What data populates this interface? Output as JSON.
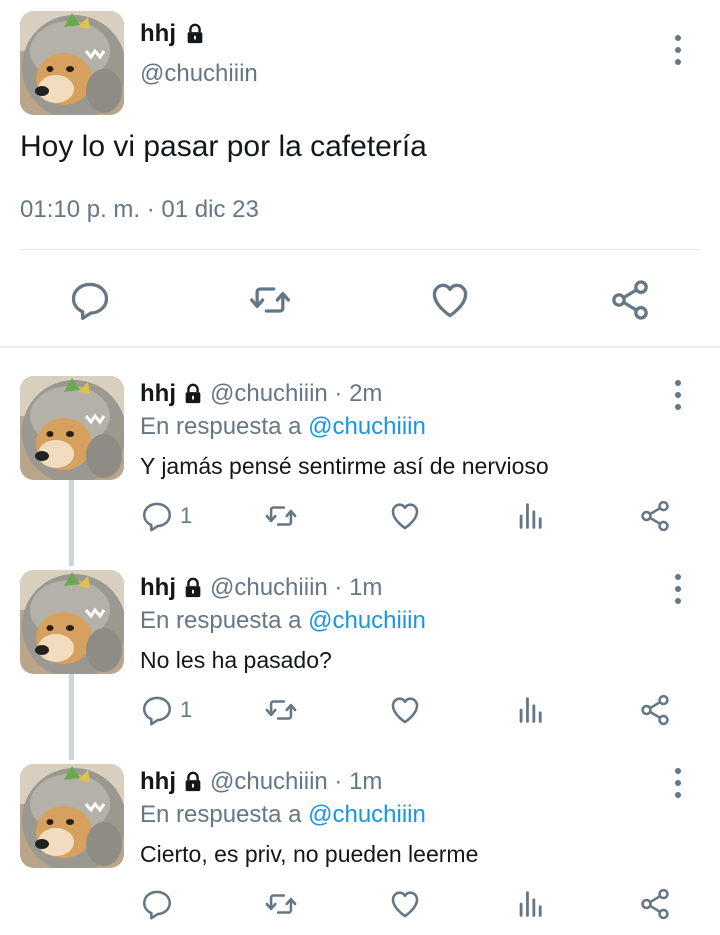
{
  "colors": {
    "text": "#14171a",
    "muted": "#657786",
    "link": "#1b95e0",
    "divider": "#e1e8ed",
    "thread": "#ccd6dd"
  },
  "tweet": {
    "name": "hhj",
    "handle": "@chuchiiin",
    "text": "Hoy lo vi pasar por la cafetería",
    "timestamp": "01:10 p. m. · 01 dic 23",
    "lock_icon": "lock-icon",
    "actions": [
      "reply-icon",
      "retweet-icon",
      "like-icon",
      "share-icon"
    ]
  },
  "replies": [
    {
      "name": "hhj",
      "handle_time": "@chuchiiin · 2m",
      "reply_prefix": "En respuesta a",
      "mention": "@chuchiiin",
      "text": "Y jamás pensé sentirme así de nervioso",
      "reply_count": "1"
    },
    {
      "name": "hhj",
      "handle_time": "@chuchiiin · 1m",
      "reply_prefix": "En respuesta a",
      "mention": "@chuchiiin",
      "text": "No les ha pasado?",
      "reply_count": "1"
    },
    {
      "name": "hhj",
      "handle_time": "@chuchiiin · 1m",
      "reply_prefix": "En respuesta a",
      "mention": "@chuchiiin",
      "text": "Cierto, es priv, no pueden leerme",
      "reply_count": ""
    }
  ]
}
